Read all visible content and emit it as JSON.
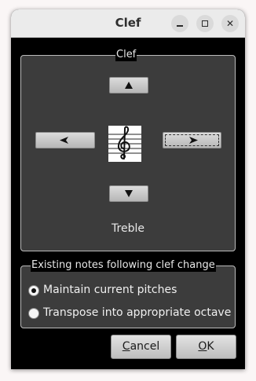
{
  "window": {
    "title": "Clef"
  },
  "clef_group": {
    "legend": "Clef",
    "current_clef": "Treble"
  },
  "icons": {
    "up": "triangle-up-icon",
    "down": "triangle-down-icon",
    "left": "arrow-left-icon",
    "right": "arrow-right-icon",
    "clef": "treble-clef-icon"
  },
  "notes_group": {
    "legend": "Existing notes following clef change",
    "options": [
      {
        "label": "Maintain current pitches",
        "checked": true
      },
      {
        "label": "Transpose into appropriate octave",
        "checked": false
      }
    ]
  },
  "buttons": {
    "cancel_first": "C",
    "cancel_rest": "ancel",
    "ok_first": "O",
    "ok_rest": "K"
  }
}
